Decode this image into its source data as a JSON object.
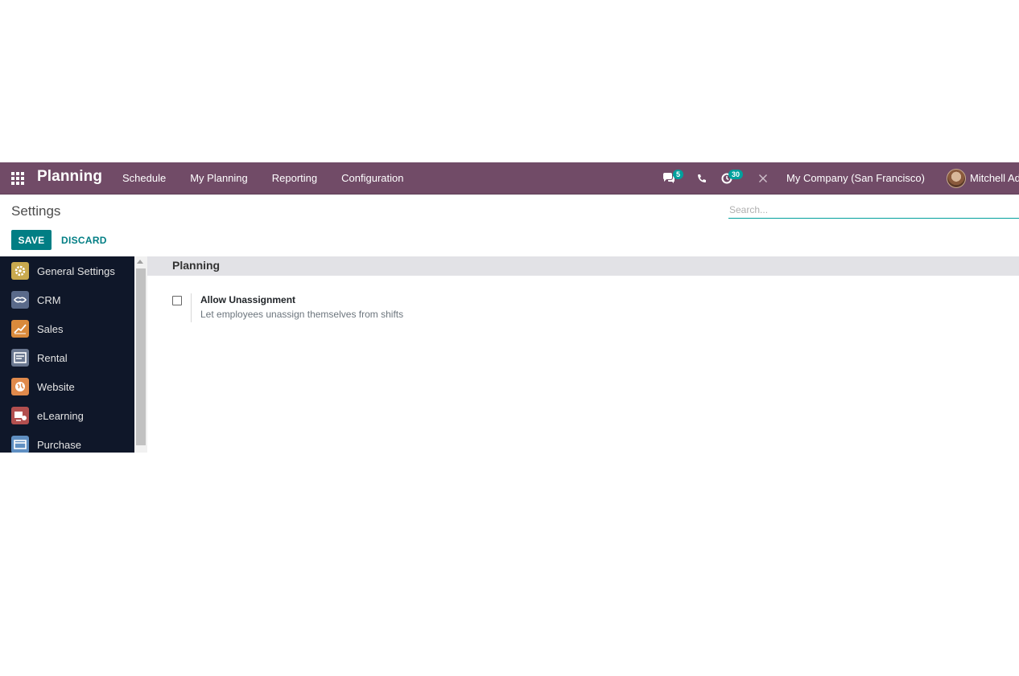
{
  "navbar": {
    "brand": "Planning",
    "menu": [
      {
        "label": "Schedule"
      },
      {
        "label": "My Planning"
      },
      {
        "label": "Reporting"
      },
      {
        "label": "Configuration"
      }
    ],
    "messages_count": "5",
    "activities_count": "30",
    "company": "My Company (San Francisco)",
    "user": "Mitchell Ad"
  },
  "control_panel": {
    "title": "Settings",
    "save_label": "SAVE",
    "discard_label": "DISCARD",
    "search_placeholder": "Search..."
  },
  "sidebar": {
    "items": [
      {
        "label": "General Settings",
        "icon": "gear-icon",
        "color": "#c9a94e"
      },
      {
        "label": "CRM",
        "icon": "handshake-icon",
        "color": "#5a6a8a"
      },
      {
        "label": "Sales",
        "icon": "chart-icon",
        "color": "#d98a3c"
      },
      {
        "label": "Rental",
        "icon": "rental-icon",
        "color": "#6b7890"
      },
      {
        "label": "Website",
        "icon": "globe-icon",
        "color": "#e08a4c"
      },
      {
        "label": "eLearning",
        "icon": "elearning-icon",
        "color": "#b24f4f"
      },
      {
        "label": "Purchase",
        "icon": "purchase-icon",
        "color": "#5f8fc2"
      }
    ]
  },
  "main": {
    "section_title": "Planning",
    "settings": [
      {
        "title": "Allow Unassignment",
        "description": "Let employees unassign themselves from shifts",
        "checked": false
      }
    ]
  },
  "colors": {
    "navbar": "#714b67",
    "accent": "#017e84",
    "sidebar": "#0f1729"
  }
}
